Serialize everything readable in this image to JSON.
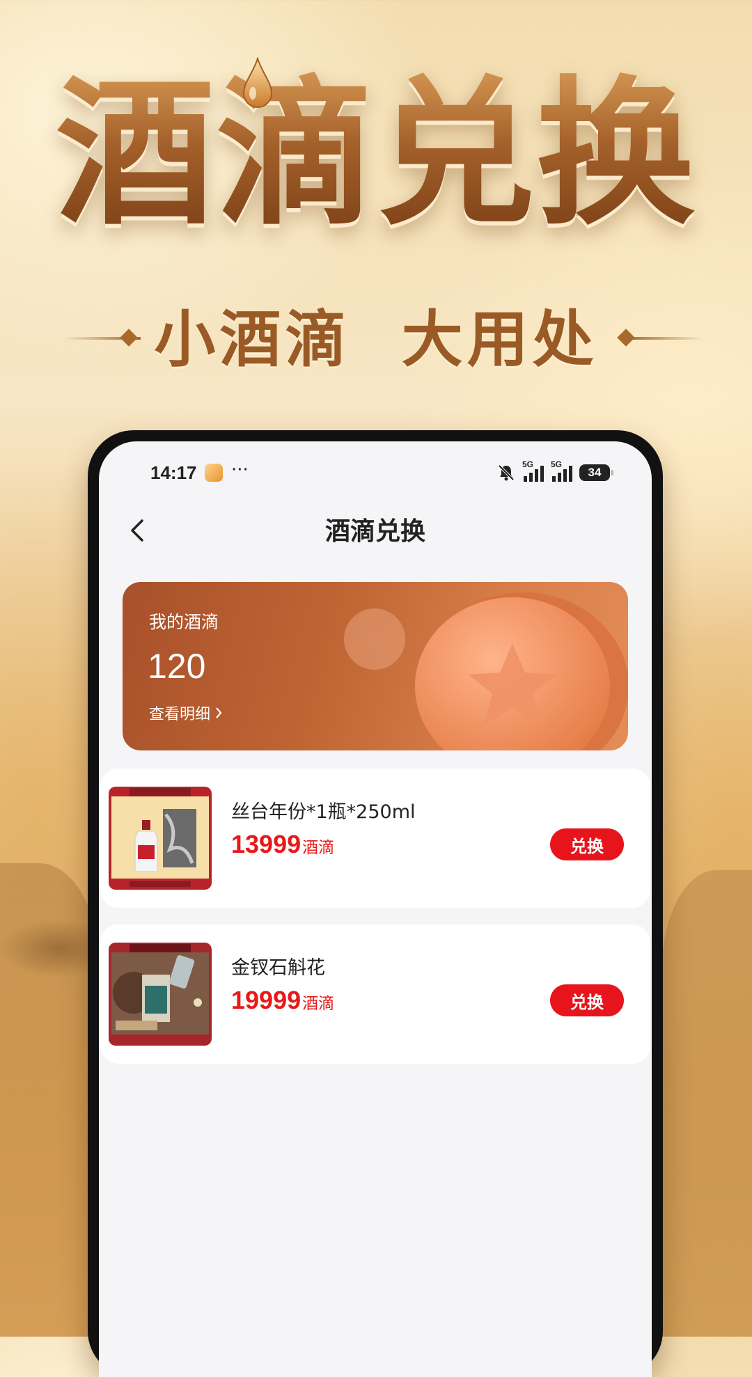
{
  "hero": {
    "title": "酒滴兑换",
    "slogan": "小酒滴  大用处"
  },
  "status_bar": {
    "time": "14:17",
    "dots": "···",
    "network_1": "5G",
    "network_2": "5G",
    "battery": "34"
  },
  "nav": {
    "title": "酒滴兑换"
  },
  "balance": {
    "label": "我的酒滴",
    "value": "120",
    "detail_link": "查看明细"
  },
  "products": [
    {
      "name": "丝台年份*1瓶*250ml",
      "price": "13999",
      "unit": "酒滴",
      "button": "兑换"
    },
    {
      "name": "金钗石斛花",
      "price": "19999",
      "unit": "酒滴",
      "button": "兑换"
    }
  ],
  "colors": {
    "accent_red": "#e8141c",
    "price_red": "#e81919",
    "card_orange": "#c0663a",
    "gold": "#a8652d"
  }
}
